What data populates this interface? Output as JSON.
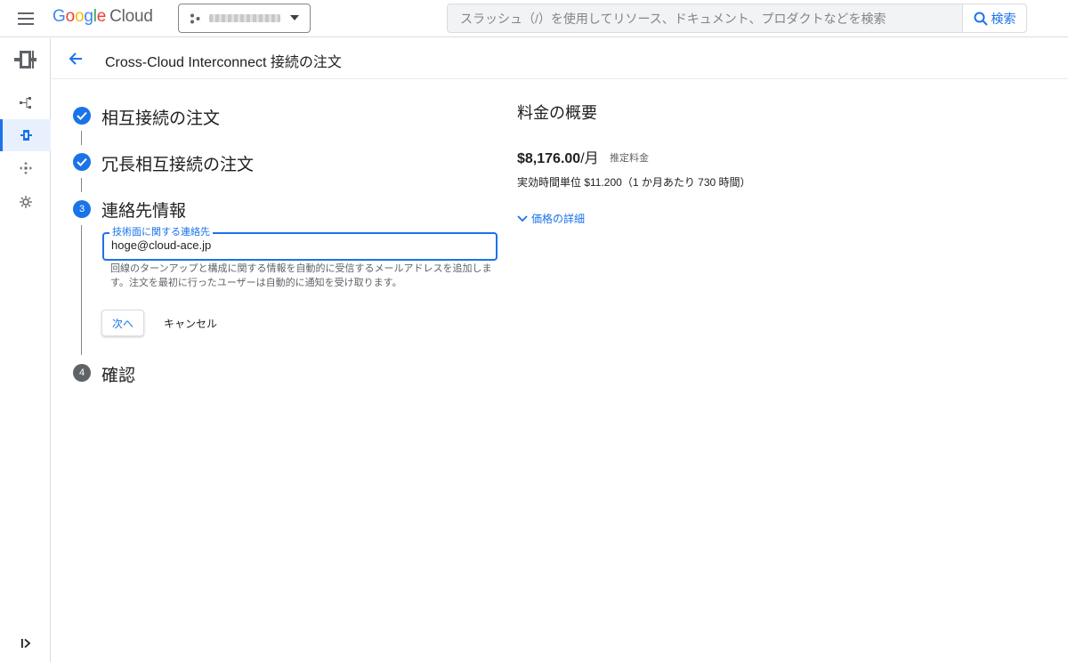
{
  "header": {
    "logo": {
      "g": "G",
      "o1": "o",
      "o2": "o",
      "g2": "g",
      "l": "l",
      "e": "e",
      "cloud": "Cloud"
    },
    "project": {
      "name": "my-project-name"
    },
    "search": {
      "placeholder": "スラッシュ（/）を使用してリソース、ドキュメント、プロダクトなどを検索",
      "button_label": "検索"
    }
  },
  "page": {
    "title": "Cross-Cloud Interconnect 接続の注文"
  },
  "stepper": {
    "steps": [
      {
        "number": "1",
        "title": "相互接続の注文",
        "state": "done"
      },
      {
        "number": "2",
        "title": "冗長相互接続の注文",
        "state": "done"
      },
      {
        "number": "3",
        "title": "連絡先情報",
        "state": "current"
      },
      {
        "number": "4",
        "title": "確認",
        "state": "pending"
      }
    ],
    "contact": {
      "label": "技術面に関する連絡先",
      "value": "hoge@cloud-ace.jp",
      "help": "回線のターンアップと構成に関する情報を自動的に受信するメールアドレスを追加します。注文を最初に行ったユーザーは自動的に通知を受け取ります。"
    },
    "next_label": "次へ",
    "cancel_label": "キャンセル"
  },
  "pricing": {
    "title": "料金の概要",
    "amount": "$8,176.00",
    "per": "/月",
    "note": "推定料金",
    "hourly": "実効時間単位 $11.200（1 か月あたり 730 時間）",
    "details_label": "価格の詳細"
  },
  "colors": {
    "accent": "#1a73e8",
    "text": "#202124",
    "muted": "#5f6368",
    "border": "#dadce0"
  },
  "icons": [
    "menu-icon",
    "project-icon",
    "caret-down-icon",
    "search-icon",
    "interconnect-icon",
    "topology-icon",
    "connection-icon",
    "network-icon",
    "settings-icon",
    "back-arrow-icon",
    "check-icon",
    "chevron-down-icon",
    "expand-rail-icon"
  ]
}
